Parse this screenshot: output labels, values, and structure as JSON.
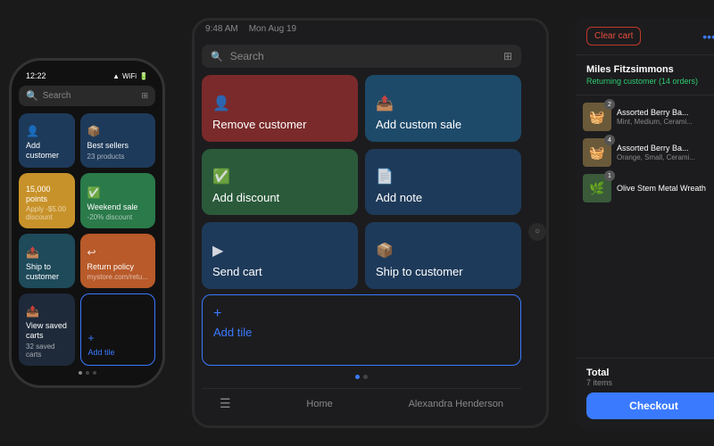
{
  "scene": {
    "background": "#1a1a1a"
  },
  "phone": {
    "status_time": "12:22",
    "status_icons": [
      "▲",
      "WiFi",
      "Batt"
    ],
    "search_placeholder": "Search",
    "tiles": [
      {
        "id": "add-customer",
        "label": "Add customer",
        "icon": "👤",
        "color": "dark-blue"
      },
      {
        "id": "best-sellers",
        "label": "Best sellers",
        "sublabel": "23 products",
        "icon": "📦",
        "color": "dark-blue2"
      },
      {
        "id": "points",
        "label": "15,000 points",
        "sublabel": "Apply -$5.00 discount",
        "color": "yellow"
      },
      {
        "id": "weekend-sale",
        "label": "Weekend sale",
        "sublabel": "-20% discount",
        "icon": "✅",
        "color": "green"
      },
      {
        "id": "ship-to-customer",
        "label": "Ship to customer",
        "icon": "📤",
        "color": "teal"
      },
      {
        "id": "return-policy",
        "label": "Return policy",
        "sublabel": "mystore.com/retu...",
        "icon": "⟲",
        "color": "orange"
      },
      {
        "id": "view-saved-carts",
        "label": "View saved carts",
        "sublabel": "32 saved carts",
        "icon": "📤",
        "color": "dark"
      },
      {
        "id": "add-tile",
        "label": "Add tile",
        "icon": "+",
        "color": "blue-outline"
      }
    ]
  },
  "tablet": {
    "time": "9:48 AM",
    "date": "Mon Aug 19",
    "search_placeholder": "Search",
    "tiles": [
      {
        "id": "remove-customer",
        "label": "Remove customer",
        "icon": "👤",
        "color": "#8b2a2a"
      },
      {
        "id": "add-custom-sale",
        "label": "Add custom sale",
        "icon": "📤",
        "color": "#1e4a6a"
      },
      {
        "id": "add-discount",
        "label": "Add discount",
        "icon": "✅",
        "color": "#2a5a3a"
      },
      {
        "id": "add-note",
        "label": "Add note",
        "icon": "📄",
        "color": "#1e3a5a"
      },
      {
        "id": "send-cart",
        "label": "Send cart",
        "icon": "▶",
        "color": "#1e3a5a"
      },
      {
        "id": "ship-to-customer",
        "label": "Ship to customer",
        "icon": "📦",
        "color": "#1e3a5a"
      }
    ],
    "add_tile_label": "Add tile",
    "add_tile_icon": "+",
    "bottom_home": "Home",
    "bottom_user": "Alexandra Henderson"
  },
  "right_panel": {
    "clear_cart_label": "Clear cart",
    "more_label": "•••",
    "customer_name": "Miles Fitzsimmons",
    "customer_status": "Returning customer (14 orders)",
    "items": [
      {
        "id": 1,
        "name": "Assorted Berry Ba...",
        "desc": "Mint, Medium, Cerami...",
        "qty": 2,
        "color": "#5a4a2a"
      },
      {
        "id": 2,
        "name": "Assorted Berry Ba...",
        "desc": "Orange, Small, Cerami...",
        "qty": 4,
        "color": "#5a4a2a"
      },
      {
        "id": 3,
        "name": "Olive Stem Metal Wreath",
        "desc": "",
        "qty": 1,
        "color": "#2a4a2a"
      }
    ],
    "total_label": "Total",
    "total_items": "7 items",
    "checkout_label": "Checkout"
  }
}
